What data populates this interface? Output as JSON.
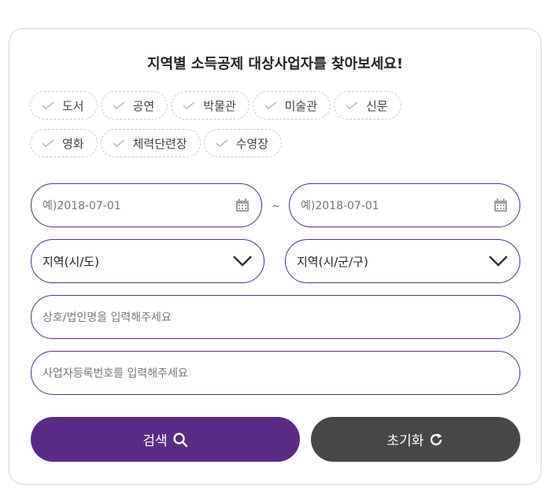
{
  "title": "지역별 소득공제 대상사업자를 찾아보세요!",
  "categories": {
    "row1": [
      "도서",
      "공연",
      "박물관",
      "미술관",
      "신문"
    ],
    "row2": [
      "영화",
      "체력단련장",
      "수영장"
    ]
  },
  "date_start": {
    "placeholder": "예)2018-07-01"
  },
  "date_separator": "~",
  "date_end": {
    "placeholder": "예)2018-07-01"
  },
  "region_sido": {
    "selected": "지역(시/도)"
  },
  "region_sigungu": {
    "selected": "지역(시/군/구)"
  },
  "company_name": {
    "placeholder": "상호/법인명을 입력해주세요"
  },
  "business_number": {
    "placeholder": "사업자등록번호를 입력해주세요"
  },
  "buttons": {
    "search": "검색",
    "reset": "초기화"
  },
  "colors": {
    "accent": "#5b2a86",
    "search_button": "#5b2a86",
    "reset_button": "#474747",
    "chip_border": "#c8c8c8"
  },
  "icons": {
    "chip": "check-icon",
    "date": "calendar-icon",
    "select": "chevron-down-icon",
    "search": "search-icon",
    "reset": "refresh-icon"
  }
}
